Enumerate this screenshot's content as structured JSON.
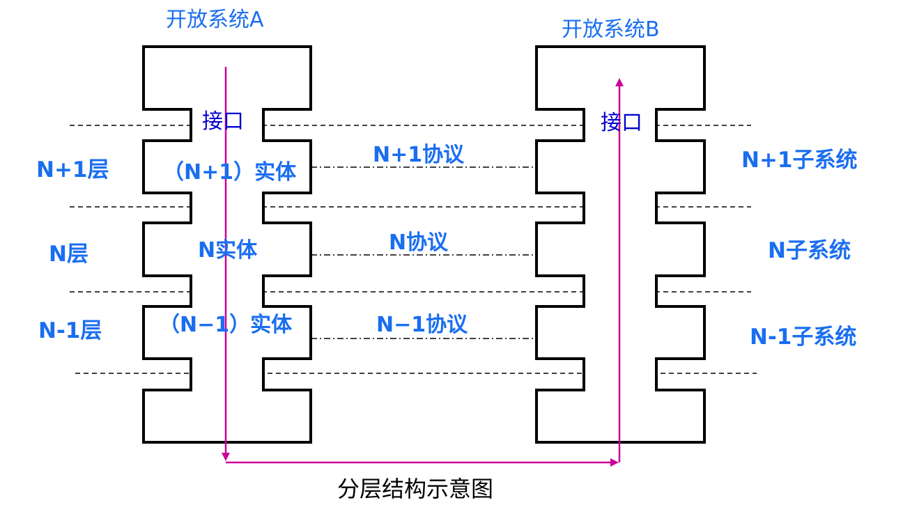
{
  "systems": {
    "a_title": "开放系统A",
    "b_title": "开放系统B"
  },
  "interfaces": {
    "a": "接口",
    "b": "接口"
  },
  "layers": {
    "upper": "N+1层",
    "middle": "N层",
    "lower": "N-1层"
  },
  "entities": {
    "upper": "（N+1）实体",
    "middle": "N实体",
    "lower": "（N−1）实体"
  },
  "protocols": {
    "upper": "N+1协议",
    "middle": "N协议",
    "lower": "N−1协议"
  },
  "subsystems": {
    "upper": "N+1子系统",
    "middle": "N子系统",
    "lower": "N-1子系统"
  },
  "caption": "分层结构示意图",
  "colors": {
    "label_blue": "#1a6ef0",
    "interface_blue": "#0000cc",
    "arrow_magenta": "#cc0099",
    "outline": "#000000"
  }
}
